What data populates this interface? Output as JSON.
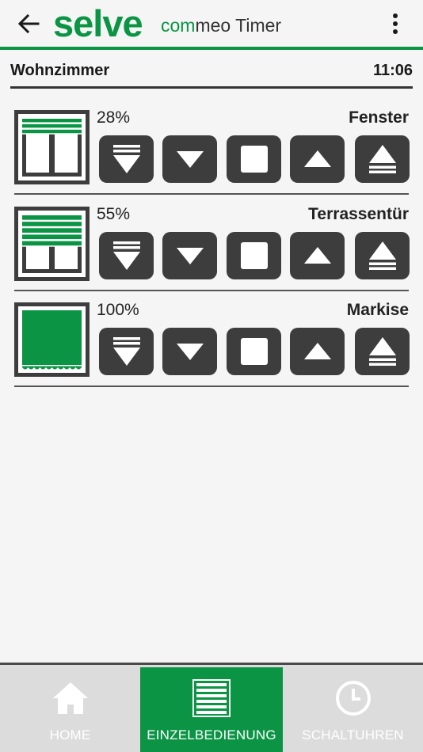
{
  "header": {
    "brand": "selve",
    "app_name_accent": "com",
    "app_name_rest": "meo Timer",
    "back_icon": "arrow-left-icon",
    "menu_icon": "more-vertical-icon"
  },
  "room": {
    "name": "Wohnzimmer",
    "time": "11:06"
  },
  "devices": [
    {
      "name": "Fenster",
      "percent_label": "28%",
      "type": "shutter",
      "closed_fraction": 0.28
    },
    {
      "name": "Terrassentür",
      "percent_label": "55%",
      "type": "shutter",
      "closed_fraction": 0.55
    },
    {
      "name": "Markise",
      "percent_label": "100%",
      "type": "awning",
      "closed_fraction": 1.0
    }
  ],
  "controls": [
    "move-down-full-icon",
    "move-down-icon",
    "stop-icon",
    "move-up-icon",
    "move-up-full-icon"
  ],
  "nav": {
    "tabs": [
      {
        "label": "HOME",
        "icon": "home-icon",
        "active": false
      },
      {
        "label": "EINZELBEDIENUNG",
        "icon": "shutter-icon",
        "active": true
      },
      {
        "label": "SCHALTUHREN",
        "icon": "clock-icon",
        "active": false
      }
    ]
  },
  "colors": {
    "brand_green": "#0a9444",
    "button_dark": "#3d3d3d",
    "nav_background": "#dcdcdc"
  }
}
